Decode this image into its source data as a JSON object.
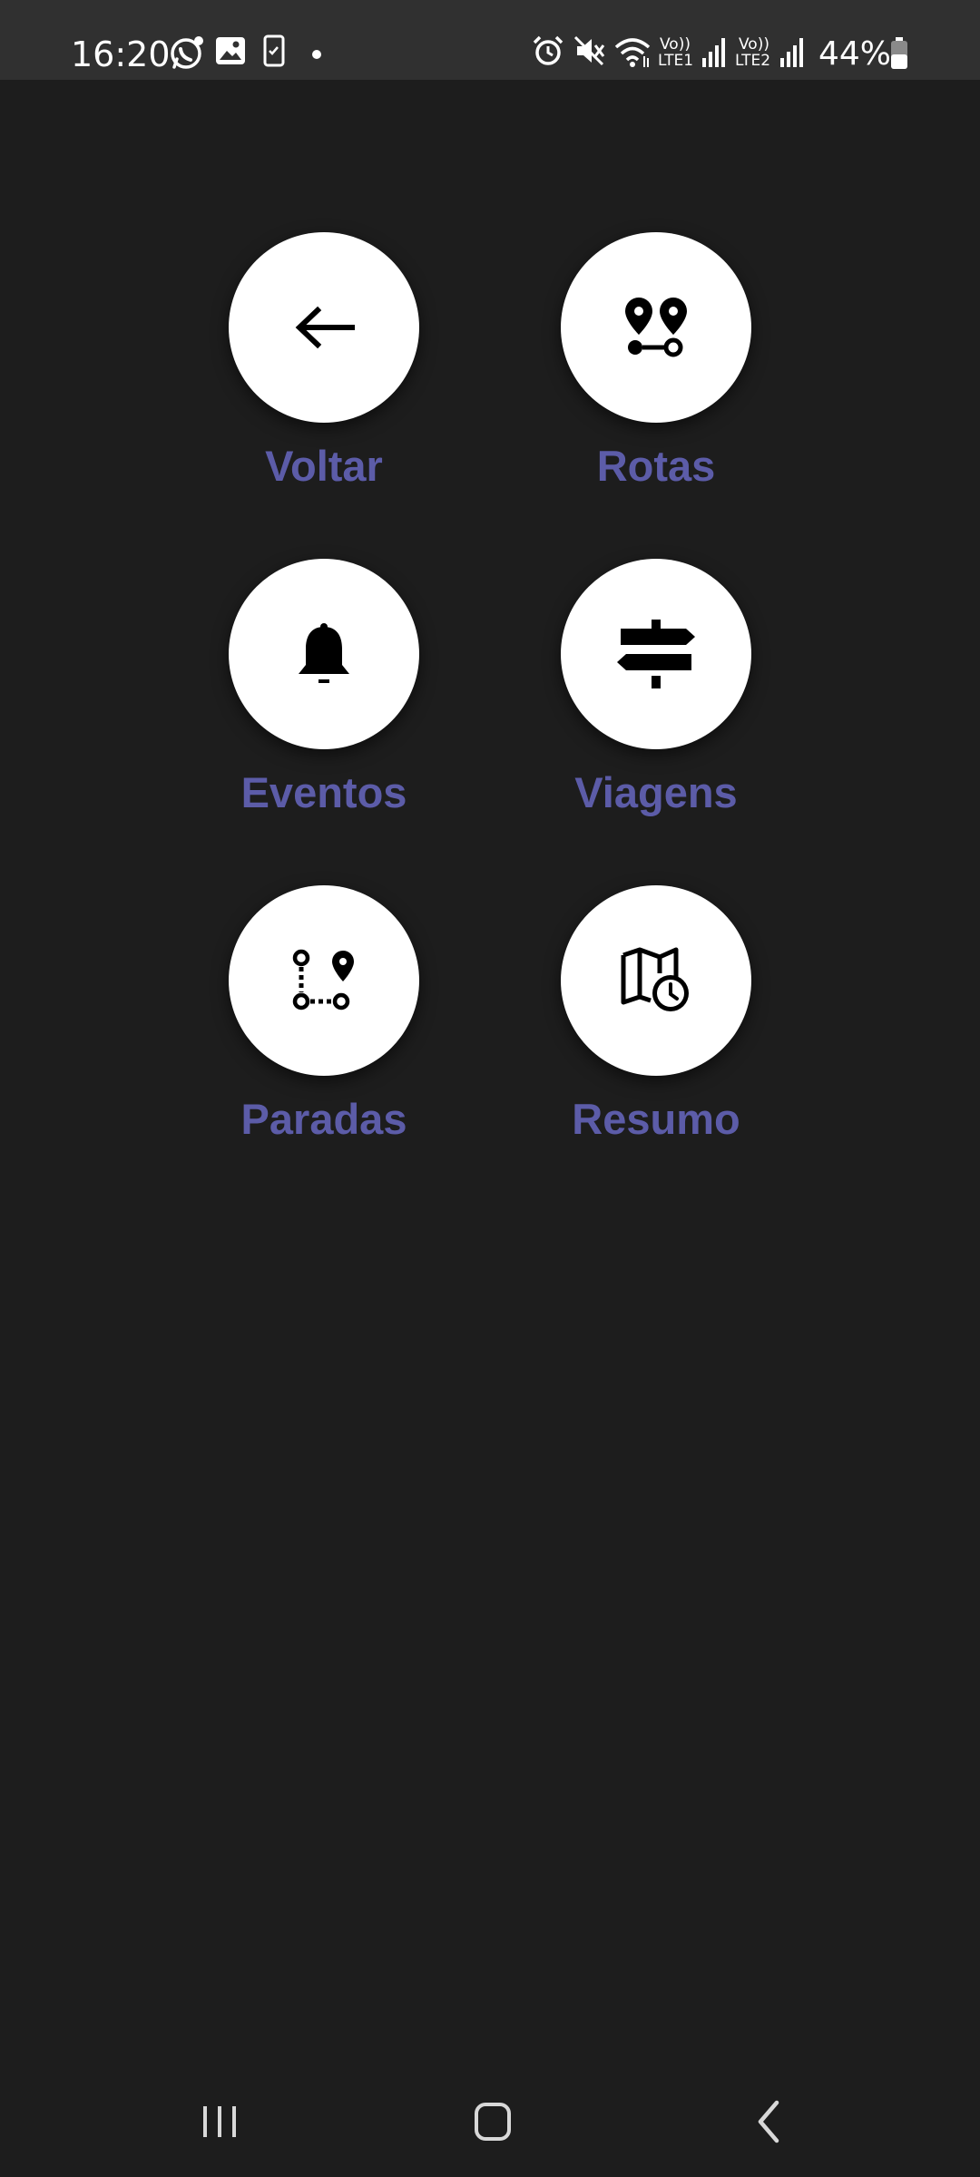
{
  "status_bar": {
    "time": "16:20",
    "left_icons": [
      "whatsapp-icon",
      "gallery-icon",
      "phone-check-icon",
      "dot-icon"
    ],
    "right_icons": [
      "alarm-icon",
      "mute-icon",
      "wifi-icon",
      "signal-lte1-icon",
      "signal-lte2-icon",
      "battery-icon"
    ],
    "lte1_label_top": "Vo))",
    "lte1_label_bottom": "LTE1",
    "lte2_label_top": "Vo))",
    "lte2_label_bottom": "LTE2",
    "battery_percent": "44%"
  },
  "menu": {
    "items": [
      {
        "label": "Voltar",
        "icon": "arrow-left-icon"
      },
      {
        "label": "Rotas",
        "icon": "route-pins-icon"
      },
      {
        "label": "Eventos",
        "icon": "bell-icon"
      },
      {
        "label": "Viagens",
        "icon": "signpost-icon"
      },
      {
        "label": "Paradas",
        "icon": "stops-route-icon"
      },
      {
        "label": "Resumo",
        "icon": "map-clock-icon"
      }
    ]
  },
  "nav_bar": {
    "buttons": [
      "recent-apps-icon",
      "home-icon",
      "back-icon"
    ]
  },
  "colors": {
    "background": "#1d1d1d",
    "status_bar": "#303030",
    "label_accent": "#5c5ca8",
    "circle": "#ffffff"
  }
}
